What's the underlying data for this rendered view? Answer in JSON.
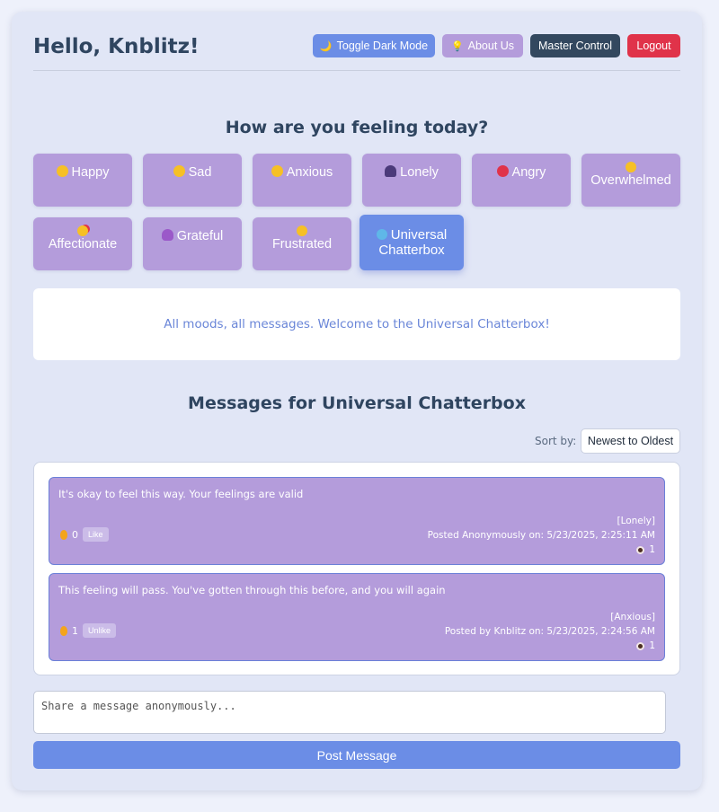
{
  "header": {
    "greeting": "Hello, Knblitz!",
    "toggle_dark_mode": "Toggle Dark Mode",
    "about_us": "About Us",
    "master_control": "Master Control",
    "logout": "Logout"
  },
  "mood_section": {
    "title": "How are you feeling today?",
    "moods": [
      {
        "label": "Happy",
        "icon": "smile-emoji-icon"
      },
      {
        "label": "Sad",
        "icon": "sad-emoji-icon"
      },
      {
        "label": "Anxious",
        "icon": "anxious-emoji-icon"
      },
      {
        "label": "Lonely",
        "icon": "person-silhouette-icon"
      },
      {
        "label": "Angry",
        "icon": "angry-emoji-icon"
      },
      {
        "label": "Overwhelmed",
        "icon": "exploding-head-emoji-icon"
      },
      {
        "label": "Affectionate",
        "icon": "hearts-face-emoji-icon"
      },
      {
        "label": "Grateful",
        "icon": "praying-person-icon"
      },
      {
        "label": "Frustrated",
        "icon": "steaming-face-emoji-icon"
      },
      {
        "label": "Universal Chatterbox",
        "icon": "globe-icon",
        "active": true
      }
    ]
  },
  "welcome": {
    "text": "All moods, all messages. Welcome to the Universal Chatterbox!"
  },
  "messages_section": {
    "title": "Messages for Universal Chatterbox",
    "sort_label": "Sort by:",
    "sort_value": "Newest to Oldest",
    "messages": [
      {
        "text": "It's okay to feel this way. Your feelings are valid",
        "mood_tag": "[Lonely]",
        "posted": "Posted Anonymously on: 5/23/2025, 2:25:11 AM",
        "likes": "0",
        "like_button": "Like",
        "views": "1"
      },
      {
        "text": "This feeling will pass. You've gotten through this before, and you will again",
        "mood_tag": "[Anxious]",
        "posted": "Posted by Knblitz on: 5/23/2025, 2:24:56 AM",
        "likes": "1",
        "like_button": "Unlike",
        "views": "1"
      }
    ]
  },
  "composer": {
    "placeholder": "Share a message anonymously...",
    "post_button": "Post Message"
  },
  "colors": {
    "mood_button": "#b49cdb",
    "active_mood": "#6b8de6",
    "logout": "#e0334a",
    "master_control": "#33485f"
  }
}
